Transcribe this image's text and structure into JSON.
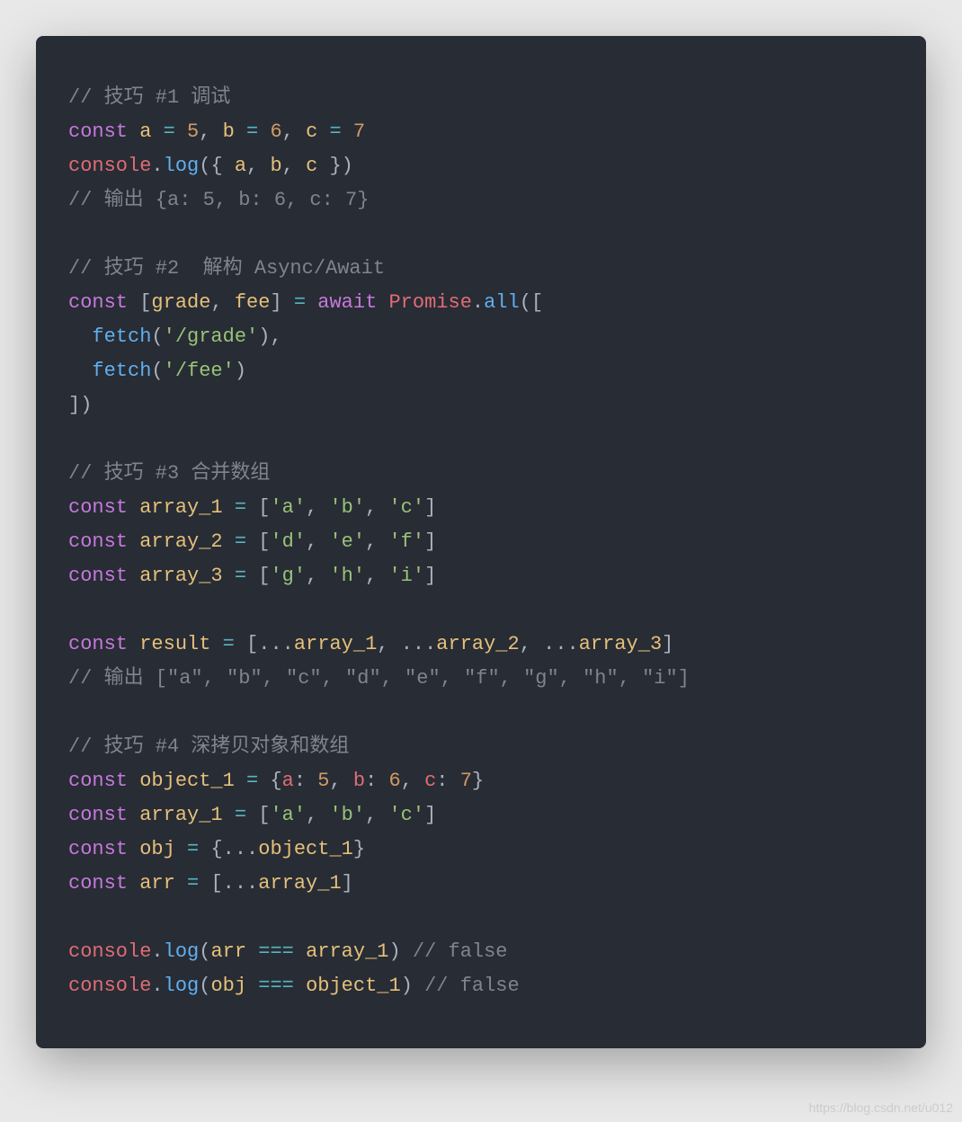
{
  "watermark": "https://blog.csdn.net/u012",
  "c": {
    "l1": "// 技巧 #1 调试",
    "kw_const": "const",
    "id_a": "a",
    "eq": " = ",
    "n5": "5",
    "comma": ", ",
    "id_b": "b",
    "n6": "6",
    "id_c": "c",
    "n7": "7",
    "l3_console": "console",
    "dot": ".",
    "l3_log": "log",
    "lparen": "(",
    "rparen": ")",
    "lbrace": "{ ",
    "rbrace": " }",
    "l4": "// 输出 {a: 5, b: 6, c: 7}",
    "l6": "// 技巧 #2  解构 Async/Await",
    "lbracket": "[",
    "rbracket": "]",
    "id_grade": "grade",
    "id_fee": "fee",
    "kw_await": "await",
    "id_Promise": "Promise",
    "m_all": "all",
    "m_fetch": "fetch",
    "s_grade": "'/grade'",
    "s_fee": "'/fee'",
    "indent2": "  ",
    "trail_comma": ",",
    "close_bp": "])",
    "l13": "// 技巧 #3 合并数组",
    "id_array1": "array_1",
    "id_array2": "array_2",
    "id_array3": "array_3",
    "s_a": "'a'",
    "s_b": "'b'",
    "s_c": "'c'",
    "s_d": "'d'",
    "s_e": "'e'",
    "s_f": "'f'",
    "s_g": "'g'",
    "s_h": "'h'",
    "s_i": "'i'",
    "id_result": "result",
    "spread": "...",
    "l19": "// 输出 [\"a\", \"b\", \"c\", \"d\", \"e\", \"f\", \"g\", \"h\", \"i\"]",
    "l21": "// 技巧 #4 深拷贝对象和数组",
    "id_object1": "object_1",
    "key_a": "a",
    "key_b": "b",
    "key_c": "c",
    "colon": ": ",
    "id_obj": "obj",
    "id_arr": "arr",
    "op_eqeqeq": " === ",
    "cm_false": " // false",
    "sp": " "
  }
}
